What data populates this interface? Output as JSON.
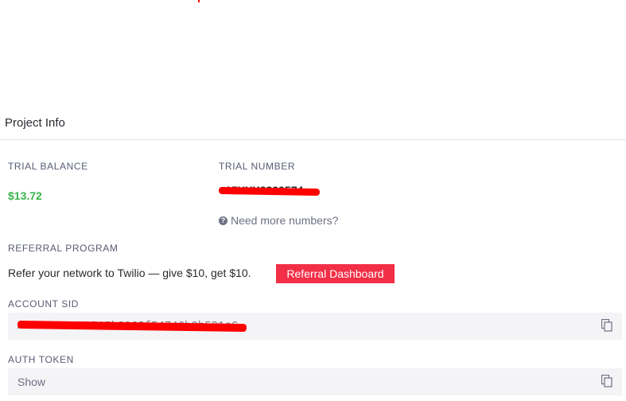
{
  "project_info": {
    "title": "Project Info",
    "trial_balance": {
      "label": "TRIAL BALANCE",
      "value": "$13.72",
      "value_color": "#36b549"
    },
    "trial_number": {
      "label": "TRIAL NUMBER",
      "value": "+15XXX8899574",
      "more_link": "Need more numbers?",
      "more_icon": "question-circle-icon"
    },
    "referral": {
      "label": "REFERRAL PROGRAM",
      "text": "Refer your network to Twilio — give $10, get $10.",
      "button_label": "Referral Dashboard",
      "button_color": "#f22f46"
    },
    "account_sid": {
      "label": "ACCOUNT SID",
      "value": "AC8XXXXXXX0795b3063f54746b0b591c6",
      "copy_icon": "copy-icon"
    },
    "auth_token": {
      "label": "AUTH TOKEN",
      "value": "Show",
      "copy_icon": "copy-icon"
    }
  }
}
